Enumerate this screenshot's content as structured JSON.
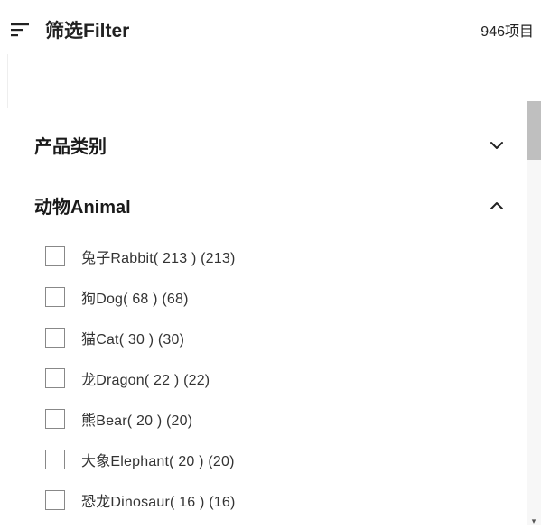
{
  "header": {
    "filter_label": "筛选Filter",
    "count_label": "946项目"
  },
  "sections": {
    "category": {
      "title": "产品类别",
      "expanded": false
    },
    "animal": {
      "title": "动物Animal",
      "expanded": true,
      "options": [
        {
          "label": "兔子Rabbit( 213 ) (213)"
        },
        {
          "label": "狗Dog( 68 ) (68)"
        },
        {
          "label": "猫Cat( 30 ) (30)"
        },
        {
          "label": "龙Dragon( 22 ) (22)"
        },
        {
          "label": "熊Bear( 20 ) (20)"
        },
        {
          "label": "大象Elephant( 20 ) (20)"
        },
        {
          "label": "恐龙Dinosaur( 16 ) (16)"
        }
      ]
    }
  }
}
